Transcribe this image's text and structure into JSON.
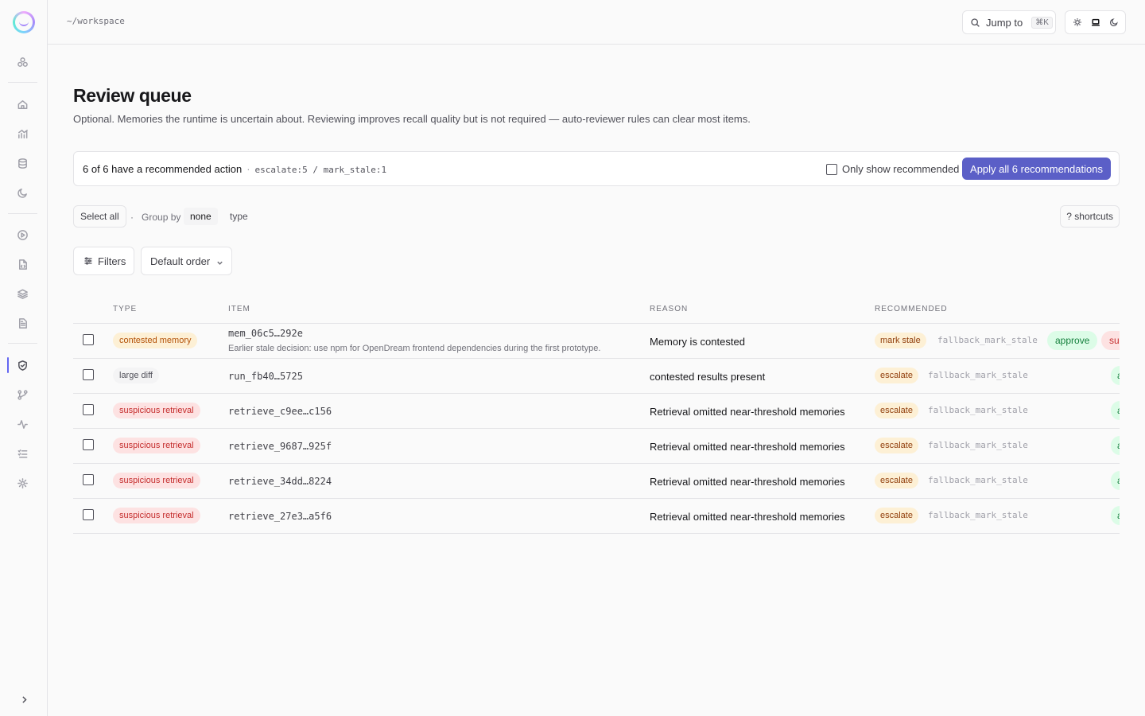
{
  "colors": {
    "accent": "#5b5fc7",
    "active_nav": "#6366f1",
    "approve_bg": "#dcfce7",
    "escalate_bg": "#fdf0d5",
    "suspicious_bg": "#fde2e2"
  },
  "sidebar": {
    "items": [
      {
        "name": "graph-icon"
      },
      {
        "name": "home-icon"
      },
      {
        "name": "chart-icon"
      },
      {
        "name": "database-icon"
      },
      {
        "name": "moon-icon"
      },
      {
        "name": "play-icon"
      },
      {
        "name": "file-code-icon"
      },
      {
        "name": "layers-icon"
      },
      {
        "name": "document-icon"
      },
      {
        "name": "shield-icon",
        "active": true
      },
      {
        "name": "branch-icon"
      },
      {
        "name": "activity-icon"
      },
      {
        "name": "checklist-icon"
      },
      {
        "name": "gear-icon"
      }
    ]
  },
  "topbar": {
    "breadcrumb": "~/workspace",
    "jump_label": "Jump to",
    "jump_kbd": "⌘K",
    "theme_options": [
      "sun-icon",
      "laptop-icon",
      "moon-icon"
    ],
    "theme_selected": "laptop-icon"
  },
  "page": {
    "title": "Review queue",
    "subtitle": "Optional. Memories the runtime is uncertain about. Reviewing improves recall quality but is not required — auto-reviewer rules can clear most items."
  },
  "recommendations": {
    "summary": "6 of 6 have a recommended action",
    "separator": "·",
    "counts": "escalate:5 / mark_stale:1",
    "only_show_label": "Only show recommended",
    "apply_label": "Apply all 6 recommendations"
  },
  "toolbar": {
    "select_all": "Select all",
    "separator": "·",
    "group_by_label": "Group by",
    "group_options": [
      "none",
      "type"
    ],
    "group_selected": "none",
    "shortcuts": "? shortcuts"
  },
  "filters": {
    "filters_label": "Filters",
    "order_value": "Default order"
  },
  "table": {
    "columns": [
      "TYPE",
      "ITEM",
      "REASON",
      "RECOMMENDED"
    ],
    "rows": [
      {
        "type": "contested memory",
        "kind": "contested",
        "item": "mem_06c5…292e",
        "desc": "Earlier stale decision: use npm for OpenDream frontend dependencies during the first prototype.",
        "reason": "Memory is contested",
        "recommended": "mark stale",
        "fallback": "fallback_mark_stale",
        "actions": [
          "approve",
          "su"
        ]
      },
      {
        "type": "large diff",
        "kind": "diff",
        "item": "run_fb40…5725",
        "desc": "",
        "reason": "contested results present",
        "recommended": "escalate",
        "fallback": "fallback_mark_stale",
        "actions": [
          "a"
        ]
      },
      {
        "type": "suspicious retrieval",
        "kind": "susp",
        "item": "retrieve_c9ee…c156",
        "desc": "",
        "reason": "Retrieval omitted near-threshold memories",
        "recommended": "escalate",
        "fallback": "fallback_mark_stale",
        "actions": [
          "a"
        ]
      },
      {
        "type": "suspicious retrieval",
        "kind": "susp",
        "item": "retrieve_9687…925f",
        "desc": "",
        "reason": "Retrieval omitted near-threshold memories",
        "recommended": "escalate",
        "fallback": "fallback_mark_stale",
        "actions": [
          "a"
        ]
      },
      {
        "type": "suspicious retrieval",
        "kind": "susp",
        "item": "retrieve_34dd…8224",
        "desc": "",
        "reason": "Retrieval omitted near-threshold memories",
        "recommended": "escalate",
        "fallback": "fallback_mark_stale",
        "actions": [
          "a"
        ]
      },
      {
        "type": "suspicious retrieval",
        "kind": "susp",
        "item": "retrieve_27e3…a5f6",
        "desc": "",
        "reason": "Retrieval omitted near-threshold memories",
        "recommended": "escalate",
        "fallback": "fallback_mark_stale",
        "actions": [
          "a"
        ]
      }
    ]
  }
}
